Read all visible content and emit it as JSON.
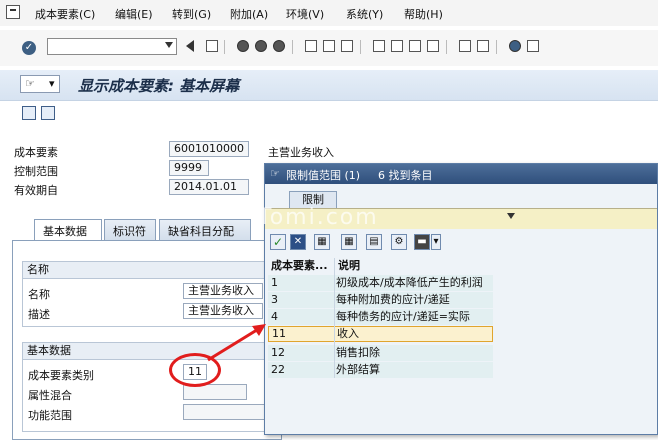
{
  "menu": {
    "items": [
      "成本要素(C)",
      "编辑(E)",
      "转到(G)",
      "附加(A)",
      "环境(V)",
      "系统(Y)",
      "帮助(H)"
    ]
  },
  "toolbar": {
    "command_value": ""
  },
  "header": {
    "title": "显示成本要素: 基本屏幕"
  },
  "form": {
    "cost_element_label": "成本要素",
    "cost_element_value": "6001010000",
    "cost_element_desc": "主营业务收入",
    "controlling_area_label": "控制范围",
    "controlling_area_value": "9999",
    "valid_from_label": "有效期自",
    "valid_from_value": "2014.01.01"
  },
  "tabs": [
    "基本数据",
    "标识符",
    "缺省科目分配"
  ],
  "names_group": {
    "title": "名称",
    "name_label": "名称",
    "name_value": "主营业务收入",
    "desc_label": "描述",
    "desc_value": "主营业务收入"
  },
  "basic_group": {
    "title": "基本数据",
    "category_label": "成本要素类别",
    "category_value": "11",
    "attr_label": "属性混合",
    "func_label": "功能范围"
  },
  "popup": {
    "title": "限制值范围 (1)",
    "found_text": "6 找到条目",
    "tab_label": "限制",
    "col_category": "成本要素...",
    "col_description": "说明",
    "rows": [
      {
        "category": "1",
        "description": "初级成本/成本降低产生的利润"
      },
      {
        "category": "3",
        "description": "每种附加费的应计/递延"
      },
      {
        "category": "4",
        "description": "每种债务的应计/递延=实际"
      },
      {
        "category": "11",
        "description": "收入"
      },
      {
        "category": "12",
        "description": "销售扣除"
      },
      {
        "category": "22",
        "description": "外部结算"
      }
    ],
    "selected_row": 3
  },
  "annotation": {
    "circle_color": "#e11d1d",
    "arrow_color": "#e11d1d"
  }
}
